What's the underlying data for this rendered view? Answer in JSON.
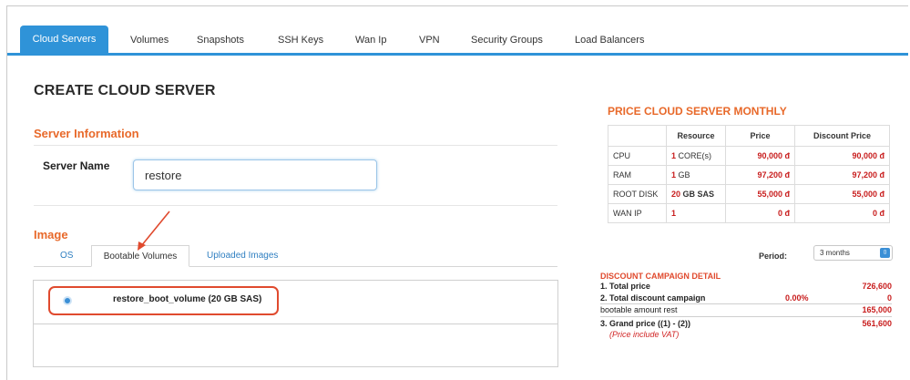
{
  "tabs": [
    "Cloud Servers",
    "Volumes",
    "Snapshots",
    "SSH Keys",
    "Wan Ip",
    "VPN",
    "Security Groups",
    "Load Balancers"
  ],
  "page_title": "CREATE CLOUD SERVER",
  "server_info": {
    "heading": "Server Information",
    "name_label": "Server Name",
    "name_value": "restore"
  },
  "image": {
    "heading": "Image",
    "tabs": [
      "OS",
      "Bootable Volumes",
      "Uploaded Images"
    ],
    "selected_volume": "restore_boot_volume (20 GB SAS)"
  },
  "price": {
    "title": "PRICE CLOUD SERVER MONTHLY",
    "headers": [
      "",
      "Resource",
      "Price",
      "Discount Price"
    ],
    "rows": [
      {
        "name": "CPU",
        "qty": "1",
        "unit": "CORE(s)",
        "price": "90,000 đ",
        "discount": "90,000 đ"
      },
      {
        "name": "RAM",
        "qty": "1",
        "unit": "GB",
        "price": "97,200 đ",
        "discount": "97,200 đ"
      },
      {
        "name": "ROOT DISK",
        "qty": "20",
        "unit": "GB SAS",
        "price": "55,000 đ",
        "discount": "55,000 đ"
      },
      {
        "name": "WAN IP",
        "qty": "1",
        "unit": "",
        "price": "0 đ",
        "discount": "0 đ"
      }
    ]
  },
  "period": {
    "label": "Period:",
    "value": "3 months"
  },
  "discount": {
    "title": "DISCOUNT CAMPAIGN DETAIL",
    "total_label": "1. Total price",
    "total_value": "726,600",
    "campaign_label": "2. Total discount campaign",
    "campaign_pct": "0.00%",
    "campaign_value": "0",
    "rest_label": "bootable amount rest",
    "rest_value": "165,000",
    "grand_label": "3. Grand price ((1) - (2))",
    "grand_value": "561,600",
    "vat_note": "(Price include VAT)"
  },
  "colors": {
    "accent": "#2f93d8",
    "orange": "#e8692a",
    "price_red": "#c81d1d",
    "annotation_red": "#e04a2e"
  }
}
